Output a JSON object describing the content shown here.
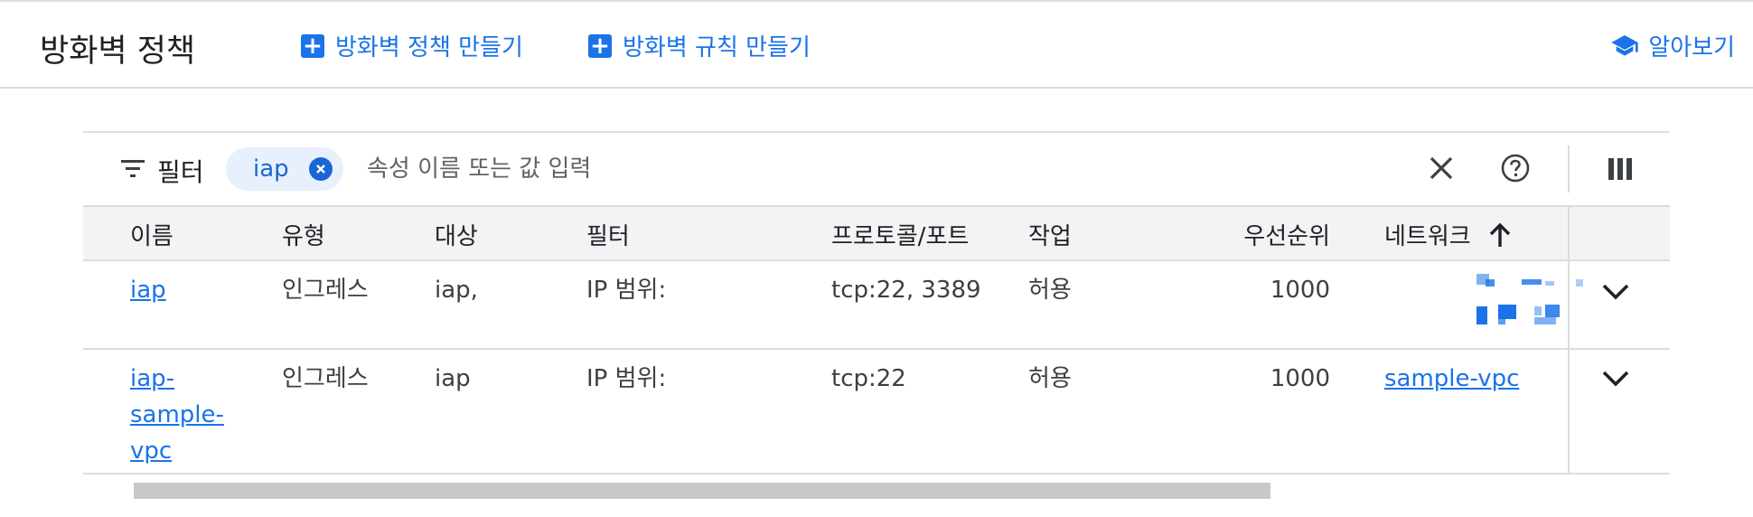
{
  "header": {
    "title": "방화벽 정책",
    "create_policy": "방화벽 정책 만들기",
    "create_rule": "방화벽 규칙 만들기",
    "learn": "알아보기"
  },
  "filter": {
    "label": "필터",
    "chip": "iap",
    "placeholder": "속성 이름 또는 값 입력"
  },
  "table": {
    "headers": {
      "name": "이름",
      "type": "유형",
      "target": "대상",
      "filter": "필터",
      "protocol": "프로토콜/포트",
      "action": "작업",
      "priority": "우선순위",
      "network": "네트워크"
    },
    "rows": [
      {
        "name": "iap",
        "type": "인그레스",
        "target": "iap,",
        "filter": "IP 범위:",
        "protocol": "tcp:22, 3389",
        "action": "허용",
        "priority": "1000",
        "network": ""
      },
      {
        "name_lines": [
          "iap-",
          "sample-",
          "vpc"
        ],
        "type": "인그레스",
        "target": "iap",
        "filter": "IP 범위:",
        "protocol": "tcp:22",
        "action": "허용",
        "priority": "1000",
        "network": "sample-vpc"
      }
    ]
  },
  "icons": {
    "add": "plus-box-icon",
    "learn": "school-cap-icon",
    "filter": "filter-lines-icon",
    "chip_remove": "cancel-circle-icon",
    "clear": "close-icon",
    "help": "help-circle-icon",
    "columns": "column-view-icon",
    "sort": "arrow-up-icon",
    "expand": "chevron-down-icon"
  },
  "colors": {
    "accent": "#1a73e8",
    "chip_bg": "#e8f0fe",
    "header_bg": "#f1f3f4",
    "border": "#dadce0"
  }
}
